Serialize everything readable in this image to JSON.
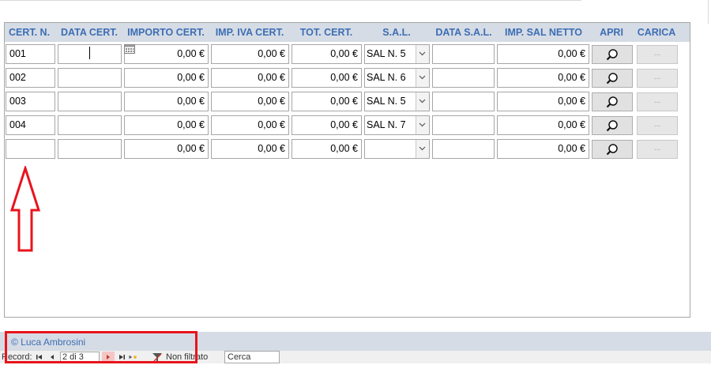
{
  "columns": {
    "cert_n": "CERT. N.",
    "data_cert": "DATA CERT.",
    "importo_cert": "IMPORTO CERT.",
    "imp_iva_cert": "IMP. IVA CERT.",
    "tot_cert": "TOT. CERT.",
    "sal": "S.A.L.",
    "data_sal": "DATA S.A.L.",
    "imp_sal_netto": "IMP. SAL NETTO",
    "apri": "APRI",
    "carica": "CARICA"
  },
  "rows": [
    {
      "cert_n": "001",
      "data_cert": "",
      "importo": "0,00 €",
      "iva": "0,00 €",
      "tot": "0,00 €",
      "sal": "SAL N. 5",
      "data_sal": "",
      "netto": "0,00 €",
      "carica": "..."
    },
    {
      "cert_n": "002",
      "data_cert": "",
      "importo": "0,00 €",
      "iva": "0,00 €",
      "tot": "0,00 €",
      "sal": "SAL N. 6",
      "data_sal": "",
      "netto": "0,00 €",
      "carica": "..."
    },
    {
      "cert_n": "003",
      "data_cert": "",
      "importo": "0,00 €",
      "iva": "0,00 €",
      "tot": "0,00 €",
      "sal": "SAL N. 5",
      "data_sal": "",
      "netto": "0,00 €",
      "carica": "..."
    },
    {
      "cert_n": "004",
      "data_cert": "",
      "importo": "0,00 €",
      "iva": "0,00 €",
      "tot": "0,00 €",
      "sal": "SAL N. 7",
      "data_sal": "",
      "netto": "0,00 €",
      "carica": "..."
    },
    {
      "cert_n": "",
      "data_cert": "",
      "importo": "0,00 €",
      "iva": "0,00 €",
      "tot": "0,00 €",
      "sal": "",
      "data_sal": "",
      "netto": "0,00 €",
      "carica": "..."
    }
  ],
  "footer": {
    "copyright": "© Luca Ambrosini"
  },
  "navigation": {
    "record_label": "Record:",
    "record_value": "2 di 3",
    "filter_label": "Non filtrato",
    "search_placeholder": "Cerca"
  },
  "icons": {
    "open_record": "magnifier-icon",
    "date_picker": "calendar-icon",
    "annotation": "up-arrow-icon"
  },
  "colors": {
    "header_text": "#3c6eb4",
    "header_band": "#d6dce5",
    "annotation_red": "#e8141c"
  }
}
